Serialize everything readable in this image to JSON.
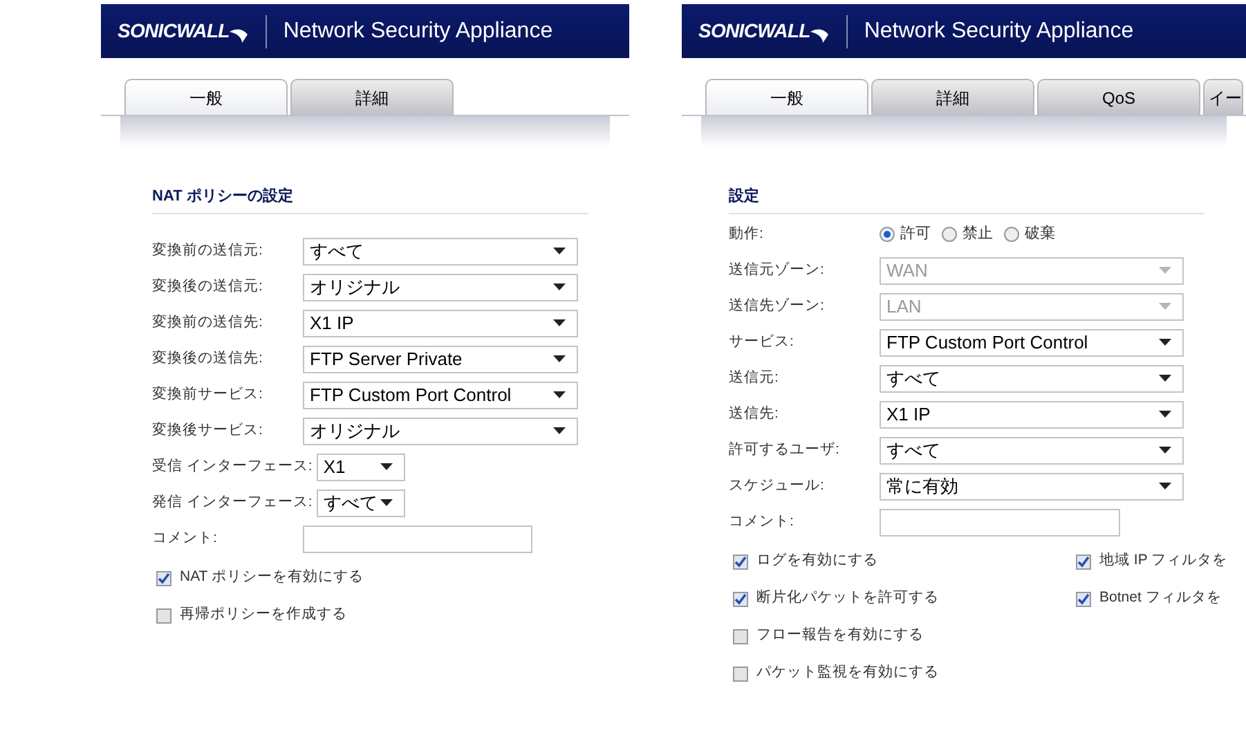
{
  "panels": [
    {
      "header": {
        "logo": "SONICWALL",
        "title": "Network Security Appliance"
      },
      "tabs": [
        {
          "label": "一般",
          "selected": true
        },
        {
          "label": "詳細",
          "selected": false
        }
      ],
      "section_title": "NAT ポリシーの設定",
      "fields": [
        {
          "kind": "select",
          "label": "変換前の送信元:",
          "value": "すべて",
          "disabled": false
        },
        {
          "kind": "select",
          "label": "変換後の送信元:",
          "value": "オリジナル",
          "disabled": false
        },
        {
          "kind": "select",
          "label": "変換前の送信先:",
          "value": "X1 IP",
          "disabled": false
        },
        {
          "kind": "select",
          "label": "変換後の送信先:",
          "value": "FTP Server Private",
          "disabled": false
        },
        {
          "kind": "select",
          "label": "変換前サービス:",
          "value": "FTP Custom Port Control",
          "disabled": false
        },
        {
          "kind": "select",
          "label": "変換後サービス:",
          "value": "オリジナル",
          "disabled": false
        },
        {
          "kind": "compact_select",
          "label": "受信 インターフェース:",
          "value": "X1",
          "disabled": false
        },
        {
          "kind": "compact_select",
          "label": "発信 インターフェース:",
          "value": "すべて",
          "disabled": false
        },
        {
          "kind": "text",
          "label": "コメント:"
        }
      ],
      "checkbox_rows": [
        [
          {
            "label": "NAT ポリシーを有効にする",
            "checked": true
          }
        ],
        [
          {
            "label": "再帰ポリシーを作成する",
            "checked": false
          }
        ]
      ]
    },
    {
      "header": {
        "logo": "SONICWALL",
        "title": "Network Security Appliance"
      },
      "tabs": [
        {
          "label": "一般",
          "selected": true
        },
        {
          "label": "詳細",
          "selected": false
        },
        {
          "label": "QoS",
          "selected": false
        },
        {
          "label": "イー",
          "selected": false
        }
      ],
      "section_title": "設定",
      "fields": [
        {
          "kind": "radio",
          "label": "動作:",
          "options": [
            {
              "label": "許可",
              "selected": true
            },
            {
              "label": "禁止",
              "selected": false
            },
            {
              "label": "破棄",
              "selected": false
            }
          ]
        },
        {
          "kind": "select",
          "label": "送信元ゾーン:",
          "value": "WAN",
          "disabled": true
        },
        {
          "kind": "select",
          "label": "送信先ゾーン:",
          "value": "LAN",
          "disabled": true
        },
        {
          "kind": "select",
          "label": "サービス:",
          "value": "FTP Custom Port Control",
          "disabled": false
        },
        {
          "kind": "select",
          "label": "送信元:",
          "value": "すべて",
          "disabled": false
        },
        {
          "kind": "select",
          "label": "送信先:",
          "value": "X1 IP",
          "disabled": false
        },
        {
          "kind": "select",
          "label": "許可するユーザ:",
          "value": "すべて",
          "disabled": false
        },
        {
          "kind": "select",
          "label": "スケジュール:",
          "value": "常に有効",
          "disabled": false
        },
        {
          "kind": "text",
          "label": "コメント:"
        }
      ],
      "checkbox_rows": [
        [
          {
            "label": "ログを有効にする",
            "checked": true
          },
          {
            "label": "地域 IP フィルタを",
            "checked": true
          }
        ],
        [
          {
            "label": "断片化パケットを許可する",
            "checked": true
          },
          {
            "label": "Botnet フィルタを",
            "checked": true
          }
        ],
        [
          {
            "label": "フロー報告を有効にする",
            "checked": false
          }
        ],
        [
          {
            "label": "パケット監視を有効にする",
            "checked": false
          }
        ]
      ]
    }
  ]
}
